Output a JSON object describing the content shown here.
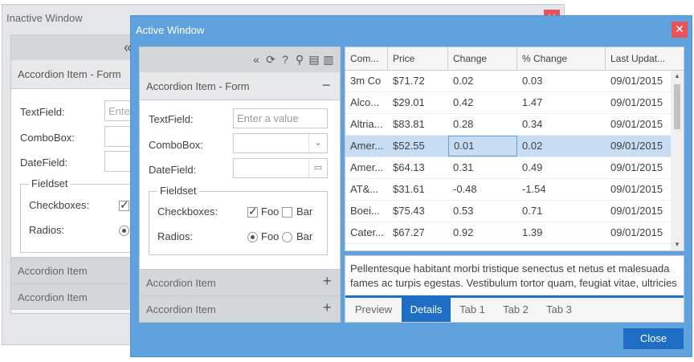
{
  "inactive_window": {
    "title": "Inactive Window",
    "close_glyph": "✕",
    "toolbar_chevron": "«",
    "accordion": {
      "form_header": "Accordion Item - Form",
      "textfield_label": "TextField:",
      "textfield_placeholder": "Enter",
      "combobox_label": "ComboBox:",
      "datefield_label": "DateField:",
      "fieldset_legend": "Fieldset",
      "checkboxes_label": "Checkboxes:",
      "radios_label": "Radios:",
      "item2": "Accordion Item",
      "item3": "Accordion Item"
    }
  },
  "active_window": {
    "title": "Active Window",
    "close_glyph": "✕",
    "close_button": "Close",
    "toolbar_icons": [
      "double-chevron-left-icon",
      "refresh-icon",
      "help-icon",
      "search-icon",
      "save-icon",
      "print-icon"
    ],
    "toolbar_glyphs": {
      "collapse": "«",
      "refresh": "⟳",
      "help": "?",
      "search": "⚲",
      "save": "▤",
      "print": "▥"
    },
    "accordion": {
      "form_header": "Accordion Item - Form",
      "collapse_tool": "−",
      "textfield_label": "TextField:",
      "textfield_placeholder": "Enter a value",
      "combobox_label": "ComboBox:",
      "combobox_value": "",
      "combobox_trigger": "⌄",
      "datefield_label": "DateField:",
      "datefield_value": "",
      "datefield_trigger": "▭",
      "fieldset_legend": "Fieldset",
      "checkboxes_label": "Checkboxes:",
      "checkbox_foo": "Foo",
      "checkbox_bar": "Bar",
      "checkbox_foo_checked": true,
      "checkbox_bar_checked": false,
      "radios_label": "Radios:",
      "radio_foo": "Foo",
      "radio_bar": "Bar",
      "radio_selected": "Foo",
      "item2": "Accordion Item",
      "item3": "Accordion Item",
      "expand_tool": "+"
    },
    "grid": {
      "columns": [
        "Com...",
        "Price",
        "Change",
        "% Change",
        "Last Updat..."
      ],
      "rows": [
        {
          "company": "3m Co",
          "price": "$71.72",
          "change": "0.02",
          "pct_change": "0.03",
          "updated": "09/01/2015"
        },
        {
          "company": "Alco...",
          "price": "$29.01",
          "change": "0.42",
          "pct_change": "1.47",
          "updated": "09/01/2015"
        },
        {
          "company": "Altria...",
          "price": "$83.81",
          "change": "0.28",
          "pct_change": "0.34",
          "updated": "09/01/2015"
        },
        {
          "company": "Amer...",
          "price": "$52.55",
          "change": "0.01",
          "pct_change": "0.02",
          "updated": "09/01/2015"
        },
        {
          "company": "Amer...",
          "price": "$64.13",
          "change": "0.31",
          "pct_change": "0.49",
          "updated": "09/01/2015"
        },
        {
          "company": "AT&...",
          "price": "$31.61",
          "change": "-0.48",
          "pct_change": "-1.54",
          "updated": "09/01/2015"
        },
        {
          "company": "Boei...",
          "price": "$75.43",
          "change": "0.53",
          "pct_change": "0.71",
          "updated": "09/01/2015"
        },
        {
          "company": "Cater...",
          "price": "$67.27",
          "change": "0.92",
          "pct_change": "1.39",
          "updated": "09/01/2015"
        }
      ],
      "selected_row_index": 3,
      "scroll_up": "▲",
      "scroll_down": "▼"
    },
    "tabpanel": {
      "body": "Pellentesque habitant morbi tristique senectus et netus et malesuada fames ac turpis egestas. Vestibulum tortor quam, feugiat vitae, ultricies",
      "tabs": [
        "Preview",
        "Details",
        "Tab 1",
        "Tab 2",
        "Tab 3"
      ],
      "active_tab": "Details"
    },
    "colors": {
      "title_bar": "#5fa2dd",
      "accent": "#1e6ec6",
      "close_red": "#e8535a",
      "selection": "#c7ddf3"
    }
  }
}
